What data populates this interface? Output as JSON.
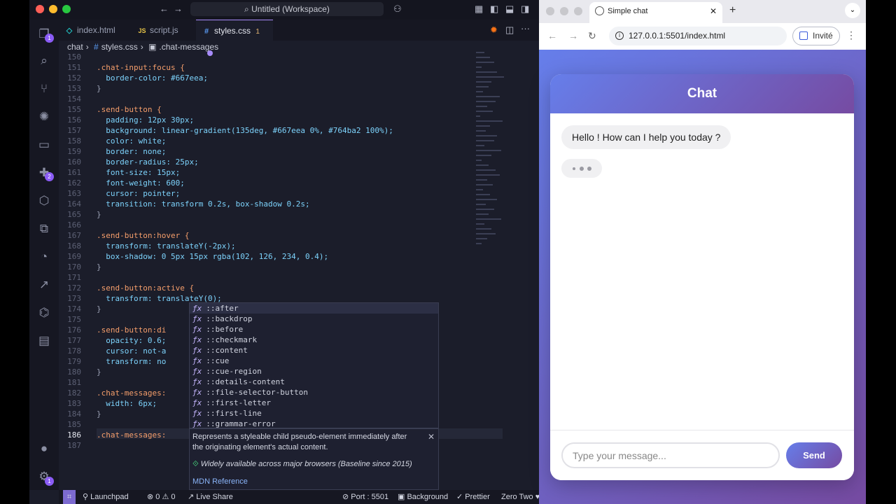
{
  "vscode": {
    "window_title": "Untitled (Workspace)",
    "tabs": [
      {
        "icon": "html-file-icon",
        "icon_glyph": "◇",
        "label": "index.html"
      },
      {
        "icon": "js-file-icon",
        "icon_glyph": "JS",
        "label": "script.js"
      },
      {
        "icon": "css-file-icon",
        "icon_glyph": "#",
        "label": "styles.css",
        "badge": "1"
      }
    ],
    "breadcrumb": [
      "chat",
      "styles.css",
      ".chat-messages"
    ],
    "activity_badges": {
      "explorer": "1",
      "extensions": "2",
      "settings": "1"
    },
    "code_lines": [
      {
        "n": "150",
        "t": ""
      },
      {
        "n": "151",
        "t": ".chat-input:focus {"
      },
      {
        "n": "152",
        "t": "  border-color: #667eea;"
      },
      {
        "n": "153",
        "t": "}"
      },
      {
        "n": "154",
        "t": ""
      },
      {
        "n": "155",
        "t": ".send-button {"
      },
      {
        "n": "156",
        "t": "  padding: 12px 30px;"
      },
      {
        "n": "157",
        "t": "  background: linear-gradient(135deg, #667eea 0%, #764ba2 100%);"
      },
      {
        "n": "158",
        "t": "  color: white;"
      },
      {
        "n": "159",
        "t": "  border: none;"
      },
      {
        "n": "160",
        "t": "  border-radius: 25px;"
      },
      {
        "n": "161",
        "t": "  font-size: 15px;"
      },
      {
        "n": "162",
        "t": "  font-weight: 600;"
      },
      {
        "n": "163",
        "t": "  cursor: pointer;"
      },
      {
        "n": "164",
        "t": "  transition: transform 0.2s, box-shadow 0.2s;"
      },
      {
        "n": "165",
        "t": "}"
      },
      {
        "n": "166",
        "t": ""
      },
      {
        "n": "167",
        "t": ".send-button:hover {"
      },
      {
        "n": "168",
        "t": "  transform: translateY(-2px);"
      },
      {
        "n": "169",
        "t": "  box-shadow: 0 5px 15px rgba(102, 126, 234, 0.4);"
      },
      {
        "n": "170",
        "t": "}"
      },
      {
        "n": "171",
        "t": ""
      },
      {
        "n": "172",
        "t": ".send-button:active {"
      },
      {
        "n": "173",
        "t": "  transform: translateY(0);"
      },
      {
        "n": "174",
        "t": "}"
      },
      {
        "n": "175",
        "t": ""
      },
      {
        "n": "176",
        "t": ".send-button:di"
      },
      {
        "n": "177",
        "t": "  opacity: 0.6;"
      },
      {
        "n": "178",
        "t": "  cursor: not-a"
      },
      {
        "n": "179",
        "t": "  transform: no"
      },
      {
        "n": "180",
        "t": "}"
      },
      {
        "n": "181",
        "t": ""
      },
      {
        "n": "182",
        "t": ".chat-messages:"
      },
      {
        "n": "183",
        "t": "  width: 6px;"
      },
      {
        "n": "184",
        "t": "}"
      },
      {
        "n": "185",
        "t": ""
      },
      {
        "n": "186",
        "t": ".chat-messages:"
      },
      {
        "n": "187",
        "t": ""
      }
    ],
    "suggestions": [
      "::after",
      "::backdrop",
      "::before",
      "::checkmark",
      "::content",
      "::cue",
      "::cue-region",
      "::details-content",
      "::file-selector-button",
      "::first-letter",
      "::first-line",
      "::grammar-error"
    ],
    "suggestion_icon": "ƒx",
    "docs": {
      "text": "Represents a styleable child pseudo-element immediately after the originating element's actual content.",
      "baseline": "Widely available across major browsers (Baseline since 2015)",
      "link": "MDN Reference"
    },
    "status": {
      "launchpad": "Launchpad",
      "errors": "0",
      "warnings": "0",
      "live_share": "Live Share",
      "port": "Port : 5501",
      "background": "Background",
      "prettier": "Prettier",
      "theme": "Zero Two"
    }
  },
  "browser": {
    "tab_title": "Simple chat",
    "url": "127.0.0.1:5501/index.html",
    "profile": "Invité",
    "chat": {
      "title": "Chat",
      "bot_message": "Hello ! How can I help you today ?",
      "input_placeholder": "Type your message...",
      "send_label": "Send"
    }
  },
  "colors": {
    "accent": "#667eea",
    "accent_end": "#764ba2",
    "editor_bg": "#1b1d2a"
  }
}
